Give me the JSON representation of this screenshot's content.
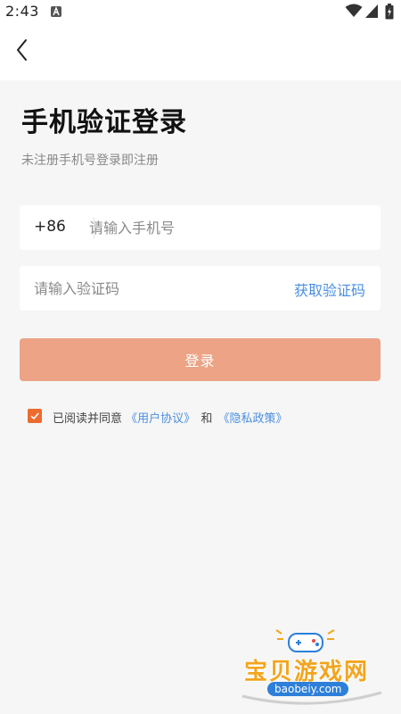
{
  "status_bar": {
    "time": "2:43",
    "icons": [
      "app-notification-icon",
      "wifi-icon",
      "signal-icon",
      "battery-icon"
    ]
  },
  "nav": {
    "back_icon": "chevron-left-icon"
  },
  "page": {
    "title": "手机验证登录",
    "subtitle": "未注册手机号登录即注册"
  },
  "phone_field": {
    "country_code": "+86",
    "placeholder": "请输入手机号",
    "value": ""
  },
  "code_field": {
    "placeholder": "请输入验证码",
    "value": "",
    "get_code_label": "获取验证码"
  },
  "login": {
    "label": "登录"
  },
  "agreement": {
    "checked": true,
    "prefix": "已阅读并同意",
    "user_agreement": "《用户协议》",
    "joiner": "和",
    "privacy_policy": "《隐私政策》"
  },
  "watermark": {
    "brand": "宝贝游戏网",
    "domain": "baobeiy.com"
  },
  "colors": {
    "accent_orange": "#eca386",
    "checkbox_orange": "#ee6b2f",
    "link_blue": "#4a8fe0",
    "background": "#f6f6f6"
  }
}
